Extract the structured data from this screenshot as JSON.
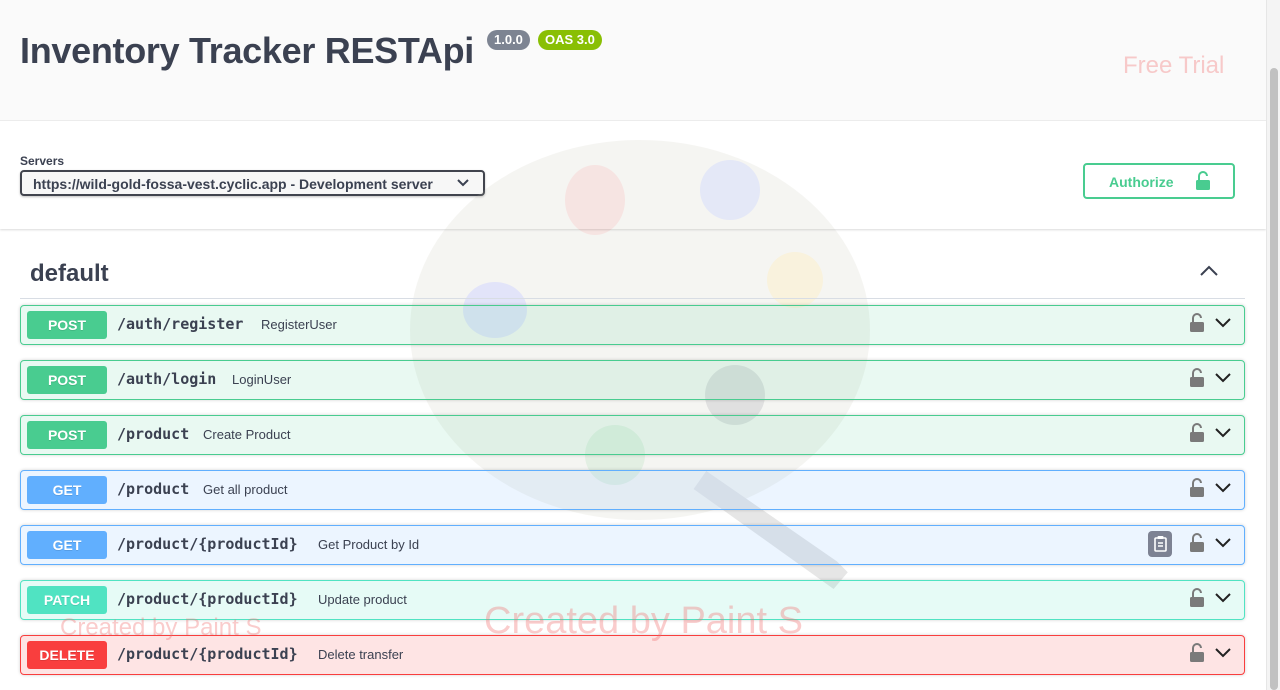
{
  "header": {
    "title": "Inventory Tracker RESTApi",
    "version": "1.0.0",
    "oas": "OAS 3.0"
  },
  "watermarks": {
    "trial": "Free Trial",
    "created_small": "Created by Paint S",
    "created_large": "Created by Paint S"
  },
  "servers": {
    "label": "Servers",
    "selected": "https://wild-gold-fossa-vest.cyclic.app - Development server"
  },
  "authorize": {
    "label": "Authorize"
  },
  "section": {
    "title": "default"
  },
  "operations": [
    {
      "method": "POST",
      "path": "/auth/register",
      "summary": "RegisterUser"
    },
    {
      "method": "POST",
      "path": "/auth/login",
      "summary": "LoginUser"
    },
    {
      "method": "POST",
      "path": "/product",
      "summary": "Create Product"
    },
    {
      "method": "GET",
      "path": "/product",
      "summary": "Get all product"
    },
    {
      "method": "GET",
      "path": "/product/{productId}",
      "summary": "Get Product by Id"
    },
    {
      "method": "PATCH",
      "path": "/product/{productId}",
      "summary": "Update product"
    },
    {
      "method": "DELETE",
      "path": "/product/{productId}",
      "summary": "Delete transfer"
    }
  ],
  "colors": {
    "post": "#49cc90",
    "get": "#61affe",
    "patch": "#50e3c2",
    "delete": "#f93e3e"
  }
}
